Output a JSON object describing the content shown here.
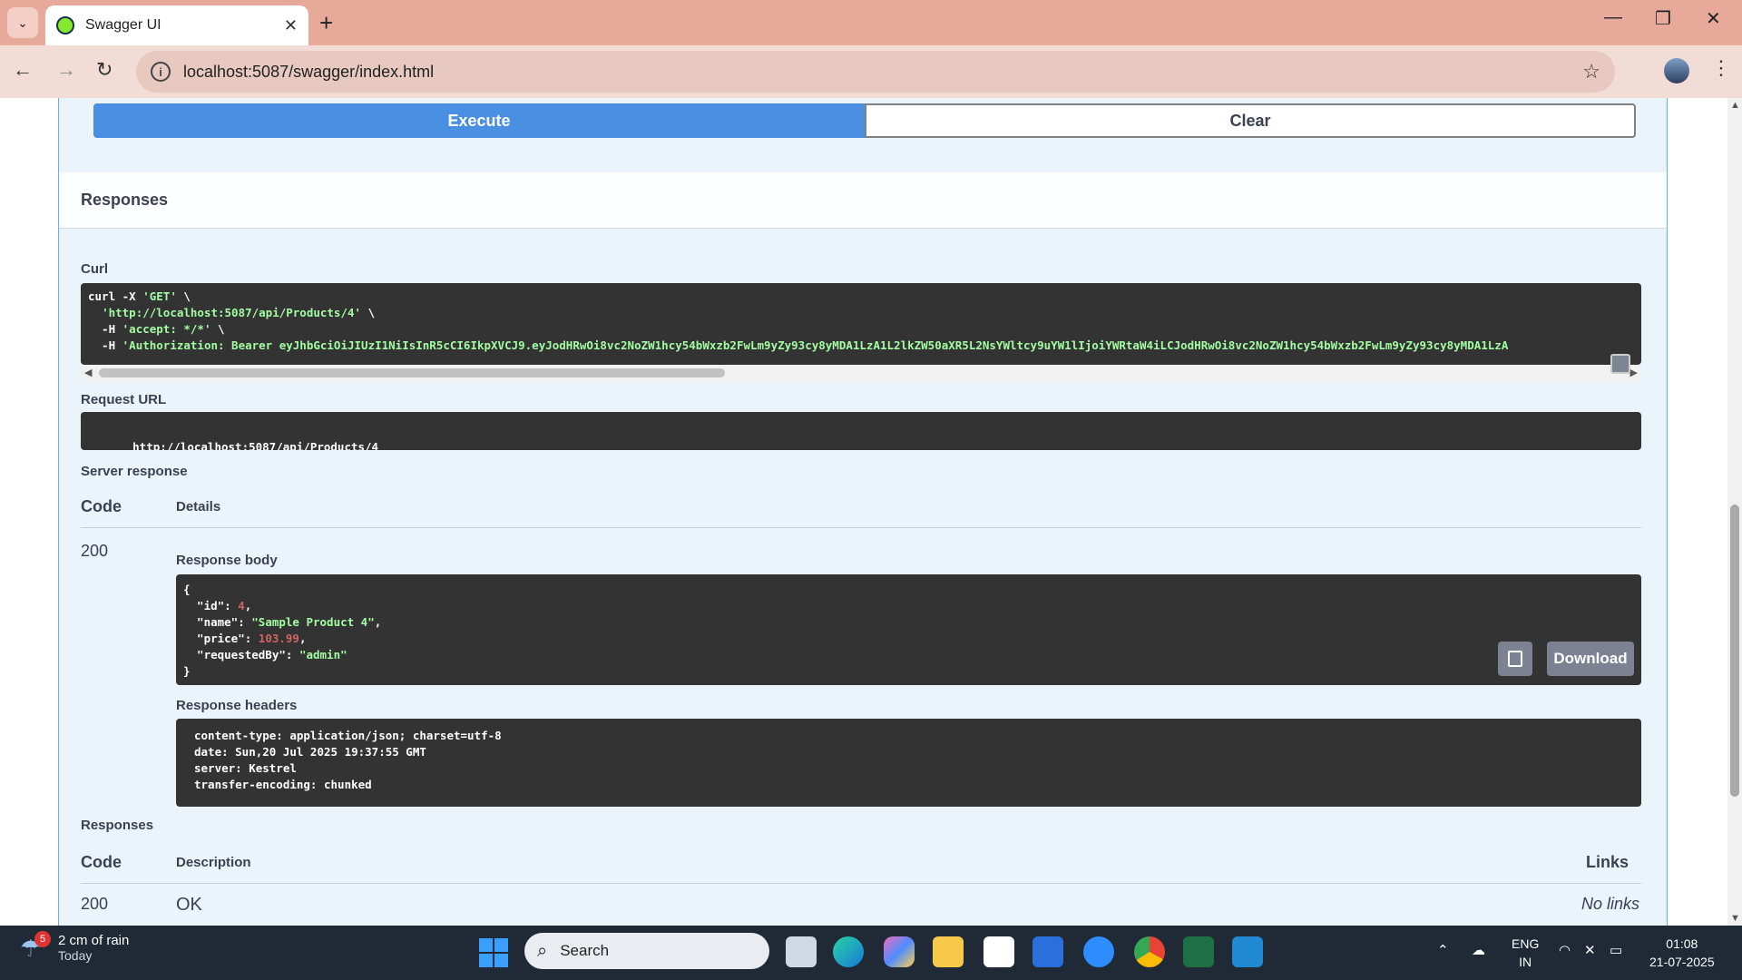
{
  "browser": {
    "tab_title": "Swagger UI",
    "tab_close": "✕",
    "new_tab": "+",
    "url": "localhost:5087/swagger/index.html",
    "window_controls": {
      "minimize": "—",
      "maximize": "❐",
      "close": "✕"
    },
    "icons": [
      "tab-menu-icon",
      "swagger-favicon",
      "back-icon",
      "forward-icon",
      "reload-icon",
      "site-info-icon",
      "bookmark-star-icon",
      "profile-avatar",
      "browser-menu-icon"
    ]
  },
  "actions": {
    "execute_label": "Execute",
    "clear_label": "Clear"
  },
  "responses_section": {
    "title": "Responses",
    "curl_label": "Curl",
    "curl_lines": [
      {
        "pre": "curl -X ",
        "str": "'GET'",
        "post": " \\"
      },
      {
        "pre": "  ",
        "str": "'http://localhost:5087/api/Products/4'",
        "post": " \\"
      },
      {
        "pre": "  -H ",
        "str": "'accept: */*'",
        "post": " \\"
      },
      {
        "pre": "  -H ",
        "str": "'Authorization: Bearer eyJhbGciOiJIUzI1NiIsInR5cCI6IkpXVCJ9.eyJodHRwOi8vc2NoZW1hcy54bWxzb2FwLm9yZy93cy8yMDA1LzA1L2lkZW50aXR5L2NsYWltcy9uYW1lIjoiYWRtaW4iLCJodHRwOi8vc2NoZW1hcy54bWxzb2FwLm9yZy93cy8yMDA1LzA",
        "post": ""
      }
    ],
    "request_url_label": "Request URL",
    "request_url": "http://localhost:5087/api/Products/4",
    "server_response_label": "Server response",
    "code_header": "Code",
    "details_header": "Details",
    "status_code": "200",
    "response_body_label": "Response body",
    "response_body": {
      "open": "{",
      "close": "}",
      "fields": [
        {
          "key": "\"id\"",
          "value": "4",
          "type": "num",
          "comma": ","
        },
        {
          "key": "\"name\"",
          "value": "\"Sample Product 4\"",
          "type": "str",
          "comma": ","
        },
        {
          "key": "\"price\"",
          "value": "103.99",
          "type": "num",
          "comma": ","
        },
        {
          "key": "\"requestedBy\"",
          "value": "\"admin\"",
          "type": "str",
          "comma": ""
        }
      ]
    },
    "download_label": "Download",
    "response_headers_label": "Response headers",
    "response_headers": [
      "content-type: application/json; charset=utf-8",
      "date: Sun,20 Jul 2025 19:37:55 GMT",
      "server: Kestrel",
      "transfer-encoding: chunked"
    ]
  },
  "responses_table": {
    "title": "Responses",
    "code_header": "Code",
    "description_header": "Description",
    "links_header": "Links",
    "rows": [
      {
        "code": "200",
        "description": "OK",
        "links": "No links"
      }
    ]
  },
  "taskbar": {
    "weather_badge": "5",
    "weather_main": "2 cm of rain",
    "weather_sub": "Today",
    "search_label": "Search",
    "lang_top": "ENG",
    "lang_bottom": "IN",
    "time": "01:08",
    "date": "21-07-2025",
    "apps": [
      "file-explorer-task-view-icon",
      "edge-icon",
      "copilot-icon",
      "folder-icon",
      "store-icon",
      "mylip-icon",
      "help-icon",
      "chrome-icon",
      "excel-icon",
      "vscode-icon"
    ]
  },
  "colors": {
    "execute_blue": "#4990e2",
    "code_bg": "#333333",
    "string_green": "#a2fca2",
    "number_red": "#d36363",
    "browser_frame": "#e6a99a"
  }
}
